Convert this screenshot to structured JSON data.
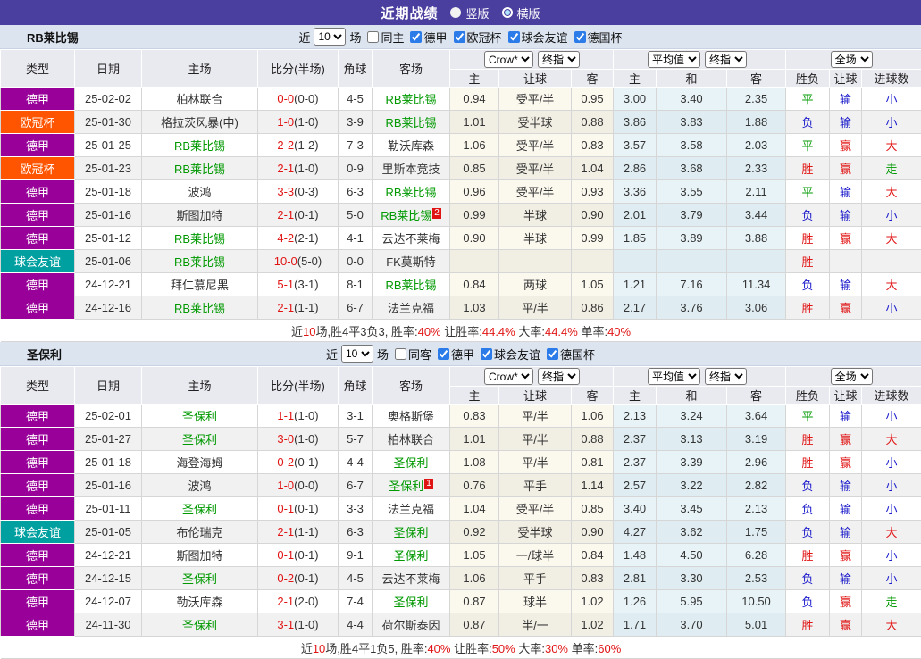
{
  "topbar": {
    "title": "近期战绩",
    "vertical_label": "竖版",
    "horizontal_label": "横版",
    "selected": "横版"
  },
  "colors": {
    "topbar_bg": "#4a3f9f",
    "bundesliga_badge": "#990099",
    "champions_badge": "#ff5500",
    "friendly_badge": "#00a0a0",
    "team_highlight_green": "#009900",
    "score_red": "#e11414",
    "win_red": "#e11414",
    "lose_blue": "#1a1acc",
    "avg_col_bg": "#e8f3f7",
    "crow_col_bg": "#fbf8ee"
  },
  "columns": {
    "left": [
      "类型",
      "日期",
      "主场",
      "比分(半场)",
      "角球",
      "客场"
    ],
    "sub": [
      "主",
      "让球",
      "客",
      "主",
      "和",
      "客",
      "胜负",
      "让球",
      "进球数"
    ]
  },
  "tables": [
    {
      "team": "RB莱比锡",
      "filter": {
        "prefix": "近",
        "count": "10",
        "suffix": "场",
        "same": {
          "label": "同主",
          "checked": false
        },
        "leagues": [
          {
            "label": "德甲",
            "checked": true
          },
          {
            "label": "欧冠杯",
            "checked": true
          },
          {
            "label": "球会友谊",
            "checked": true
          },
          {
            "label": "德国杯",
            "checked": true
          }
        ]
      },
      "selects": {
        "bookmaker": "Crow*",
        "bookmaker_time": "终指",
        "average": "平均值",
        "average_time": "终指",
        "scope": "全场"
      },
      "rows": [
        {
          "league": "德甲",
          "league_type": "dj",
          "date": "25-02-02",
          "home": "柏林联合",
          "home_link": false,
          "home_mark": "",
          "score": "0-0",
          "half": "(0-0)",
          "corner": "4-5",
          "away": "RB莱比锡",
          "away_link": true,
          "away_mark": "",
          "odds": [
            "0.94",
            "受平/半",
            "0.95"
          ],
          "avg": [
            "3.00",
            "3.40",
            "2.35"
          ],
          "result": [
            [
              "平",
              "g"
            ],
            [
              "输",
              "b"
            ],
            [
              "小",
              "b"
            ]
          ]
        },
        {
          "league": "欧冠杯",
          "league_type": "og",
          "date": "25-01-30",
          "home": "格拉茨风暴(中)",
          "home_link": false,
          "home_mark": "",
          "score": "1-0",
          "half": "(1-0)",
          "corner": "3-9",
          "away": "RB莱比锡",
          "away_link": true,
          "away_mark": "",
          "odds": [
            "1.01",
            "受半球",
            "0.88"
          ],
          "avg": [
            "3.86",
            "3.83",
            "1.88"
          ],
          "result": [
            [
              "负",
              "b"
            ],
            [
              "输",
              "b"
            ],
            [
              "小",
              "b"
            ]
          ]
        },
        {
          "league": "德甲",
          "league_type": "dj",
          "date": "25-01-25",
          "home": "RB莱比锡",
          "home_link": true,
          "home_mark": "",
          "score": "2-2",
          "half": "(1-2)",
          "corner": "7-3",
          "away": "勒沃库森",
          "away_link": false,
          "away_mark": "",
          "odds": [
            "1.06",
            "受平/半",
            "0.83"
          ],
          "avg": [
            "3.57",
            "3.58",
            "2.03"
          ],
          "result": [
            [
              "平",
              "g"
            ],
            [
              "赢",
              "r"
            ],
            [
              "大",
              "r"
            ]
          ]
        },
        {
          "league": "欧冠杯",
          "league_type": "og",
          "date": "25-01-23",
          "home": "RB莱比锡",
          "home_link": true,
          "home_mark": "",
          "score": "2-1",
          "half": "(1-0)",
          "corner": "0-9",
          "away": "里斯本竞技",
          "away_link": false,
          "away_mark": "",
          "odds": [
            "0.85",
            "受平/半",
            "1.04"
          ],
          "avg": [
            "2.86",
            "3.68",
            "2.33"
          ],
          "result": [
            [
              "胜",
              "r"
            ],
            [
              "赢",
              "r"
            ],
            [
              "走",
              "g"
            ]
          ]
        },
        {
          "league": "德甲",
          "league_type": "dj",
          "date": "25-01-18",
          "home": "波鸿",
          "home_link": false,
          "home_mark": "",
          "score": "3-3",
          "half": "(0-3)",
          "corner": "6-3",
          "away": "RB莱比锡",
          "away_link": true,
          "away_mark": "",
          "odds": [
            "0.96",
            "受平/半",
            "0.93"
          ],
          "avg": [
            "3.36",
            "3.55",
            "2.11"
          ],
          "result": [
            [
              "平",
              "g"
            ],
            [
              "输",
              "b"
            ],
            [
              "大",
              "r"
            ]
          ]
        },
        {
          "league": "德甲",
          "league_type": "dj",
          "date": "25-01-16",
          "home": "斯图加特",
          "home_link": false,
          "home_mark": "",
          "score": "2-1",
          "half": "(0-1)",
          "corner": "5-0",
          "away": "RB莱比锡",
          "away_link": true,
          "away_mark": "2",
          "odds": [
            "0.99",
            "半球",
            "0.90"
          ],
          "avg": [
            "2.01",
            "3.79",
            "3.44"
          ],
          "result": [
            [
              "负",
              "b"
            ],
            [
              "输",
              "b"
            ],
            [
              "小",
              "b"
            ]
          ]
        },
        {
          "league": "德甲",
          "league_type": "dj",
          "date": "25-01-12",
          "home": "RB莱比锡",
          "home_link": true,
          "home_mark": "",
          "score": "4-2",
          "half": "(2-1)",
          "corner": "4-1",
          "away": "云达不莱梅",
          "away_link": false,
          "away_mark": "",
          "odds": [
            "0.90",
            "半球",
            "0.99"
          ],
          "avg": [
            "1.85",
            "3.89",
            "3.88"
          ],
          "result": [
            [
              "胜",
              "r"
            ],
            [
              "赢",
              "r"
            ],
            [
              "大",
              "r"
            ]
          ]
        },
        {
          "league": "球会友谊",
          "league_type": "qy",
          "date": "25-01-06",
          "home": "RB莱比锡",
          "home_link": true,
          "home_mark": "",
          "score": "10-0",
          "half": "(5-0)",
          "corner": "0-0",
          "away": "FK莫斯特",
          "away_link": false,
          "away_mark": "",
          "odds": [
            "",
            "",
            ""
          ],
          "avg": [
            "",
            "",
            ""
          ],
          "result": [
            [
              "胜",
              "r"
            ],
            [
              "",
              ""
            ],
            [
              "",
              ""
            ]
          ]
        },
        {
          "league": "德甲",
          "league_type": "dj",
          "date": "24-12-21",
          "home": "拜仁慕尼黑",
          "home_link": false,
          "home_mark": "",
          "score": "5-1",
          "half": "(3-1)",
          "corner": "8-1",
          "away": "RB莱比锡",
          "away_link": true,
          "away_mark": "",
          "odds": [
            "0.84",
            "两球",
            "1.05"
          ],
          "avg": [
            "1.21",
            "7.16",
            "11.34"
          ],
          "result": [
            [
              "负",
              "b"
            ],
            [
              "输",
              "b"
            ],
            [
              "大",
              "r"
            ]
          ]
        },
        {
          "league": "德甲",
          "league_type": "dj",
          "date": "24-12-16",
          "home": "RB莱比锡",
          "home_link": true,
          "home_mark": "",
          "score": "2-1",
          "half": "(1-1)",
          "corner": "6-7",
          "away": "法兰克福",
          "away_link": false,
          "away_mark": "",
          "odds": [
            "1.03",
            "平/半",
            "0.86"
          ],
          "avg": [
            "2.17",
            "3.76",
            "3.06"
          ],
          "result": [
            [
              "胜",
              "r"
            ],
            [
              "赢",
              "r"
            ],
            [
              "小",
              "b"
            ]
          ]
        }
      ],
      "summary": [
        [
          "近",
          "k"
        ],
        [
          "10",
          "r"
        ],
        [
          "场,胜4平3负3, 胜率:",
          "k"
        ],
        [
          "40%",
          "r"
        ],
        [
          " 让胜率:",
          "k"
        ],
        [
          "44.4%",
          "r"
        ],
        [
          " 大率:",
          "k"
        ],
        [
          "44.4%",
          "r"
        ],
        [
          " 单率:",
          "k"
        ],
        [
          "40%",
          "r"
        ]
      ]
    },
    {
      "team": "圣保利",
      "filter": {
        "prefix": "近",
        "count": "10",
        "suffix": "场",
        "same": {
          "label": "同客",
          "checked": false
        },
        "leagues": [
          {
            "label": "德甲",
            "checked": true
          },
          {
            "label": "球会友谊",
            "checked": true
          },
          {
            "label": "德国杯",
            "checked": true
          }
        ]
      },
      "selects": {
        "bookmaker": "Crow*",
        "bookmaker_time": "终指",
        "average": "平均值",
        "average_time": "终指",
        "scope": "全场"
      },
      "rows": [
        {
          "league": "德甲",
          "league_type": "dj",
          "date": "25-02-01",
          "home": "圣保利",
          "home_link": true,
          "home_mark": "",
          "score": "1-1",
          "half": "(1-0)",
          "corner": "3-1",
          "away": "奥格斯堡",
          "away_link": false,
          "away_mark": "",
          "odds": [
            "0.83",
            "平/半",
            "1.06"
          ],
          "avg": [
            "2.13",
            "3.24",
            "3.64"
          ],
          "result": [
            [
              "平",
              "g"
            ],
            [
              "输",
              "b"
            ],
            [
              "小",
              "b"
            ]
          ]
        },
        {
          "league": "德甲",
          "league_type": "dj",
          "date": "25-01-27",
          "home": "圣保利",
          "home_link": true,
          "home_mark": "",
          "score": "3-0",
          "half": "(1-0)",
          "corner": "5-7",
          "away": "柏林联合",
          "away_link": false,
          "away_mark": "",
          "odds": [
            "1.01",
            "平/半",
            "0.88"
          ],
          "avg": [
            "2.37",
            "3.13",
            "3.19"
          ],
          "result": [
            [
              "胜",
              "r"
            ],
            [
              "赢",
              "r"
            ],
            [
              "大",
              "r"
            ]
          ]
        },
        {
          "league": "德甲",
          "league_type": "dj",
          "date": "25-01-18",
          "home": "海登海姆",
          "home_link": false,
          "home_mark": "",
          "score": "0-2",
          "half": "(0-1)",
          "corner": "4-4",
          "away": "圣保利",
          "away_link": true,
          "away_mark": "",
          "odds": [
            "1.08",
            "平/半",
            "0.81"
          ],
          "avg": [
            "2.37",
            "3.39",
            "2.96"
          ],
          "result": [
            [
              "胜",
              "r"
            ],
            [
              "赢",
              "r"
            ],
            [
              "小",
              "b"
            ]
          ]
        },
        {
          "league": "德甲",
          "league_type": "dj",
          "date": "25-01-16",
          "home": "波鸿",
          "home_link": false,
          "home_mark": "",
          "score": "1-0",
          "half": "(0-0)",
          "corner": "6-7",
          "away": "圣保利",
          "away_link": true,
          "away_mark": "1",
          "odds": [
            "0.76",
            "平手",
            "1.14"
          ],
          "avg": [
            "2.57",
            "3.22",
            "2.82"
          ],
          "result": [
            [
              "负",
              "b"
            ],
            [
              "输",
              "b"
            ],
            [
              "小",
              "b"
            ]
          ]
        },
        {
          "league": "德甲",
          "league_type": "dj",
          "date": "25-01-11",
          "home": "圣保利",
          "home_link": true,
          "home_mark": "",
          "score": "0-1",
          "half": "(0-1)",
          "corner": "3-3",
          "away": "法兰克福",
          "away_link": false,
          "away_mark": "",
          "odds": [
            "1.04",
            "受平/半",
            "0.85"
          ],
          "avg": [
            "3.40",
            "3.45",
            "2.13"
          ],
          "result": [
            [
              "负",
              "b"
            ],
            [
              "输",
              "b"
            ],
            [
              "小",
              "b"
            ]
          ]
        },
        {
          "league": "球会友谊",
          "league_type": "qy",
          "date": "25-01-05",
          "home": "布伦瑞克",
          "home_link": false,
          "home_mark": "",
          "score": "2-1",
          "half": "(1-1)",
          "corner": "6-3",
          "away": "圣保利",
          "away_link": true,
          "away_mark": "",
          "odds": [
            "0.92",
            "受半球",
            "0.90"
          ],
          "avg": [
            "4.27",
            "3.62",
            "1.75"
          ],
          "result": [
            [
              "负",
              "b"
            ],
            [
              "输",
              "b"
            ],
            [
              "大",
              "r"
            ]
          ]
        },
        {
          "league": "德甲",
          "league_type": "dj",
          "date": "24-12-21",
          "home": "斯图加特",
          "home_link": false,
          "home_mark": "",
          "score": "0-1",
          "half": "(0-1)",
          "corner": "9-1",
          "away": "圣保利",
          "away_link": true,
          "away_mark": "",
          "odds": [
            "1.05",
            "一/球半",
            "0.84"
          ],
          "avg": [
            "1.48",
            "4.50",
            "6.28"
          ],
          "result": [
            [
              "胜",
              "r"
            ],
            [
              "赢",
              "r"
            ],
            [
              "小",
              "b"
            ]
          ]
        },
        {
          "league": "德甲",
          "league_type": "dj",
          "date": "24-12-15",
          "home": "圣保利",
          "home_link": true,
          "home_mark": "",
          "score": "0-2",
          "half": "(0-1)",
          "corner": "4-5",
          "away": "云达不莱梅",
          "away_link": false,
          "away_mark": "",
          "odds": [
            "1.06",
            "平手",
            "0.83"
          ],
          "avg": [
            "2.81",
            "3.30",
            "2.53"
          ],
          "result": [
            [
              "负",
              "b"
            ],
            [
              "输",
              "b"
            ],
            [
              "小",
              "b"
            ]
          ]
        },
        {
          "league": "德甲",
          "league_type": "dj",
          "date": "24-12-07",
          "home": "勒沃库森",
          "home_link": false,
          "home_mark": "",
          "score": "2-1",
          "half": "(2-0)",
          "corner": "7-4",
          "away": "圣保利",
          "away_link": true,
          "away_mark": "",
          "odds": [
            "0.87",
            "球半",
            "1.02"
          ],
          "avg": [
            "1.26",
            "5.95",
            "10.50"
          ],
          "result": [
            [
              "负",
              "b"
            ],
            [
              "赢",
              "r"
            ],
            [
              "走",
              "g"
            ]
          ]
        },
        {
          "league": "德甲",
          "league_type": "dj",
          "date": "24-11-30",
          "home": "圣保利",
          "home_link": true,
          "home_mark": "",
          "score": "3-1",
          "half": "(1-0)",
          "corner": "4-4",
          "away": "荷尔斯泰因",
          "away_link": false,
          "away_mark": "",
          "odds": [
            "0.87",
            "半/一",
            "1.02"
          ],
          "avg": [
            "1.71",
            "3.70",
            "5.01"
          ],
          "result": [
            [
              "胜",
              "r"
            ],
            [
              "赢",
              "r"
            ],
            [
              "大",
              "r"
            ]
          ]
        }
      ],
      "summary": [
        [
          "近",
          "k"
        ],
        [
          "10",
          "r"
        ],
        [
          "场,胜4平1负5, 胜率:",
          "k"
        ],
        [
          "40%",
          "r"
        ],
        [
          " 让胜率:",
          "k"
        ],
        [
          "50%",
          "r"
        ],
        [
          " 大率:",
          "k"
        ],
        [
          "30%",
          "r"
        ],
        [
          " 单率:",
          "k"
        ],
        [
          "60%",
          "r"
        ]
      ]
    }
  ]
}
